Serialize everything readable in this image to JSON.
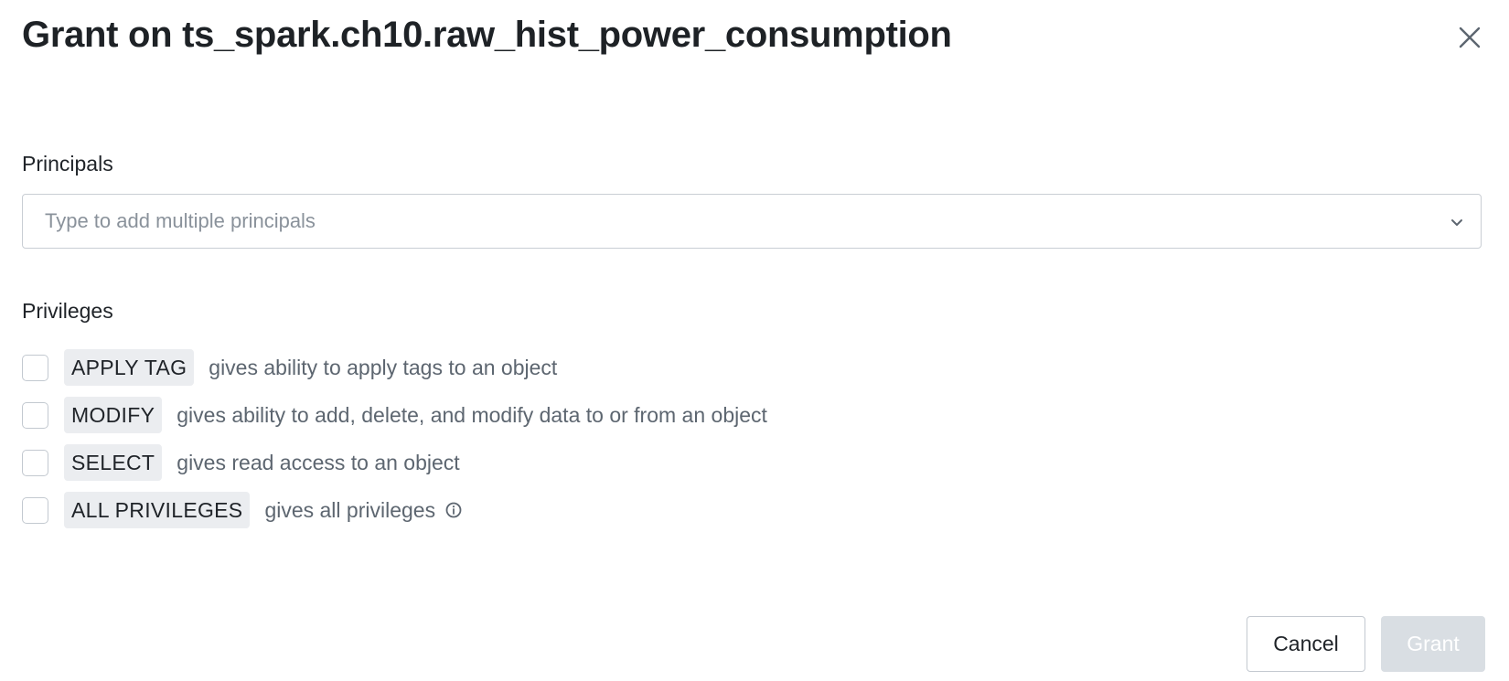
{
  "dialog": {
    "title": "Grant on ts_spark.ch10.raw_hist_power_consumption",
    "close_icon": "close-icon"
  },
  "principals": {
    "label": "Principals",
    "placeholder": "Type to add multiple principals",
    "chevron_icon": "chevron-down-icon"
  },
  "privileges": {
    "label": "Privileges",
    "items": [
      {
        "tag": "APPLY TAG",
        "description": "gives ability to apply tags to an object",
        "checked": false
      },
      {
        "tag": "MODIFY",
        "description": "gives ability to add, delete, and modify data to or from an object",
        "checked": false
      },
      {
        "tag": "SELECT",
        "description": "gives read access to an object",
        "checked": false
      },
      {
        "tag": "ALL PRIVILEGES",
        "description": "gives all privileges",
        "checked": false,
        "info_icon": "info-icon"
      }
    ]
  },
  "footer": {
    "cancel_label": "Cancel",
    "grant_label": "Grant",
    "grant_disabled": true
  },
  "colors": {
    "title_text": "#1e2226",
    "placeholder_text": "#8a929b",
    "description_text": "#5d6670",
    "tag_background": "#ebedf0",
    "border": "#c3c9d0",
    "grant_disabled_bg": "#d9dee3"
  }
}
